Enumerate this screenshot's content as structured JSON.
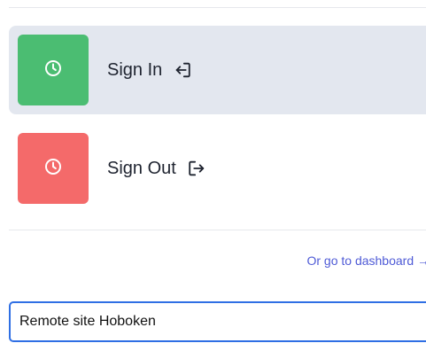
{
  "actions": {
    "sign_in": {
      "label": "Sign In",
      "icon": "login-icon",
      "tile_icon": "clock-icon",
      "color": "#4bbd72",
      "selected": true
    },
    "sign_out": {
      "label": "Sign Out",
      "icon": "logout-icon",
      "tile_icon": "clock-icon",
      "color": "#f46a6a",
      "selected": false
    }
  },
  "dashboard_link": {
    "label": "Or go to dashboard →"
  },
  "site_input": {
    "value": "Remote site Hoboken"
  },
  "colors": {
    "selected_row_bg": "#e3e7ef",
    "link": "#4e5ad6",
    "input_border": "#2f6fe4"
  }
}
